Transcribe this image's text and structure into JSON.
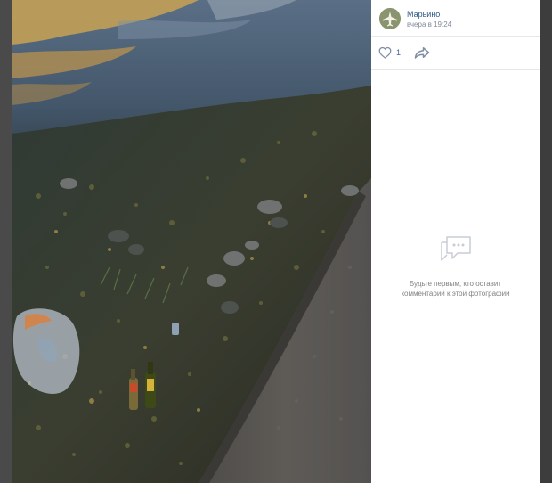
{
  "post": {
    "author_name": "Марьино",
    "post_time": "вчера в 19:24",
    "likes_count": "1"
  },
  "comments": {
    "empty_text": "Будьте первым, кто оставит комментарий к этой фотографии"
  },
  "icons": {
    "avatar": "plane-logo-icon",
    "like": "heart-icon",
    "share": "share-arrow-icon",
    "empty_comments": "comment-bubble-icon"
  },
  "colors": {
    "link": "#2a5885",
    "meta": "#818c99",
    "panel_bg": "#ffffff",
    "divider": "#e7e8ec"
  }
}
